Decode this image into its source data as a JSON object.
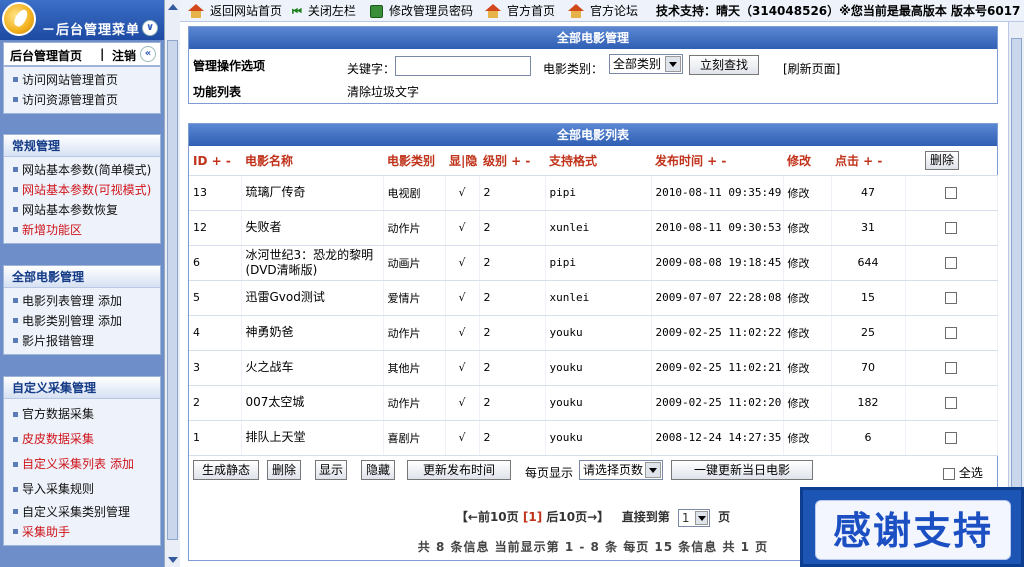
{
  "sidebar": {
    "head_title": "－后台管理菜单",
    "tab_home": "后台管理首页",
    "tab_sep": "|",
    "tab_logout": "注销",
    "nav_links": [
      "访问网站管理首页",
      "访问资源管理首页"
    ],
    "sections": [
      {
        "title": "常规管理",
        "items": [
          {
            "label": "网站基本参数(简单模式)",
            "extra": ""
          },
          {
            "label": "网站基本参数(可视模式)",
            "extra": ""
          },
          {
            "label": "网站基本参数恢复",
            "extra": ""
          },
          {
            "label": "新增功能区",
            "extra": ""
          }
        ]
      },
      {
        "title": "全部电影管理",
        "items": [
          {
            "label": "电影列表管理",
            "extra": "添加"
          },
          {
            "label": "电影类别管理",
            "extra": "添加"
          },
          {
            "label": "影片报错管理",
            "extra": ""
          }
        ]
      },
      {
        "title": "自定义采集管理",
        "items": [
          {
            "label": "官方数据采集",
            "extra": ""
          },
          {
            "label": "皮皮数据采集",
            "extra": ""
          },
          {
            "label": "自定义采集列表",
            "extra": "添加"
          },
          {
            "label": "导入采集规则",
            "extra": ""
          },
          {
            "label": "自定义采集类别管理",
            "extra": ""
          },
          {
            "label": "采集助手",
            "extra": ""
          }
        ]
      }
    ]
  },
  "topbar": {
    "back_home": "返回网站首页",
    "close_left": "关闭左栏",
    "change_pwd": "修改管理员密码",
    "official_home": "官方首页",
    "official_forum": "官方论坛",
    "support": "技术支持：晴天（314048526）※您当前是最高版本 版本号6017"
  },
  "search_panel": {
    "title": "全部电影管理",
    "ops_label": "管理操作选项",
    "keyword_label": "关键字：",
    "keyword_value": "",
    "category_label": "电影类别：",
    "category_value": "全部类别",
    "search_button": "立刻查找",
    "refresh": "[刷新页面]",
    "func_label": "功能列表",
    "clear_text": "清除垃圾文字"
  },
  "list_panel": {
    "title": "全部电影列表",
    "headers": {
      "id": "ID + -",
      "name": "电影名称",
      "category": "电影类别",
      "show_hide": "显|隐",
      "level": "级别 + -",
      "format": "支持格式",
      "time": "发布时间 + -",
      "edit": "修改",
      "clicks": "点击 + -",
      "delete_button": "删除"
    },
    "rows": [
      {
        "id": "13",
        "name": "琉璃厂传奇",
        "category": "电视剧",
        "show": "√",
        "level": "2",
        "format": "pipi",
        "time": "2010-08-11 09:35:49",
        "edit": "修改",
        "clicks": "47"
      },
      {
        "id": "12",
        "name": "失败者",
        "category": "动作片",
        "show": "√",
        "level": "2",
        "format": "xunlei",
        "time": "2010-08-11 09:30:53",
        "edit": "修改",
        "clicks": "31"
      },
      {
        "id": "6",
        "name": "冰河世纪3：恐龙的黎明(DVD清晰版)",
        "category": "动画片",
        "show": "√",
        "level": "2",
        "format": "pipi",
        "time": "2009-08-08 19:18:45",
        "edit": "修改",
        "clicks": "644"
      },
      {
        "id": "5",
        "name": "迅雷Gvod测试",
        "category": "爱情片",
        "show": "√",
        "level": "2",
        "format": "xunlei",
        "time": "2009-07-07 22:28:08",
        "edit": "修改",
        "clicks": "15"
      },
      {
        "id": "4",
        "name": "神勇奶爸",
        "category": "动作片",
        "show": "√",
        "level": "2",
        "format": "youku",
        "time": "2009-02-25 11:02:22",
        "edit": "修改",
        "clicks": "25"
      },
      {
        "id": "3",
        "name": "火之战车",
        "category": "其他片",
        "show": "√",
        "level": "2",
        "format": "youku",
        "time": "2009-02-25 11:02:21",
        "edit": "修改",
        "clicks": "70"
      },
      {
        "id": "2",
        "name": "007太空城",
        "category": "动作片",
        "show": "√",
        "level": "2",
        "format": "youku",
        "time": "2009-02-25 11:02:20",
        "edit": "修改",
        "clicks": "182"
      },
      {
        "id": "1",
        "name": "排队上天堂",
        "category": "喜剧片",
        "show": "√",
        "level": "2",
        "format": "youku",
        "time": "2008-12-24 14:27:35",
        "edit": "修改",
        "clicks": "6"
      }
    ],
    "actions": {
      "generate_static": "生成静态",
      "delete": "删除",
      "show": "显示",
      "hide": "隐藏",
      "update_time": "更新发布时间",
      "per_page_label": "每页显示",
      "per_page_value": "请选择页数",
      "update_today": "一键更新当日电影",
      "select_all": "全选"
    },
    "pager": {
      "prev": "【←前10页",
      "current": "[1]",
      "next": "后10页→】",
      "goto_label": "直接到第",
      "page_value": "1",
      "page_unit": "页"
    },
    "summary": "共 8 条信息 当前显示第 1 - 8 条 每页 15 条信息 共 1 页"
  },
  "thanks_banner": "感谢支持"
}
